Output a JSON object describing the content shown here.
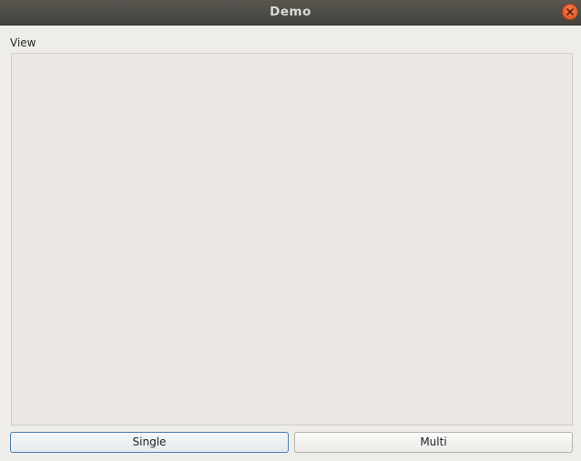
{
  "window": {
    "title": "Demo",
    "close_icon": "close-icon"
  },
  "view": {
    "label": "View"
  },
  "buttons": {
    "single_label": "Single",
    "multi_label": "Multi"
  },
  "colors": {
    "titlebar": "#4f4d48",
    "close_button": "#e95420",
    "focus_border": "#4e7dab"
  }
}
